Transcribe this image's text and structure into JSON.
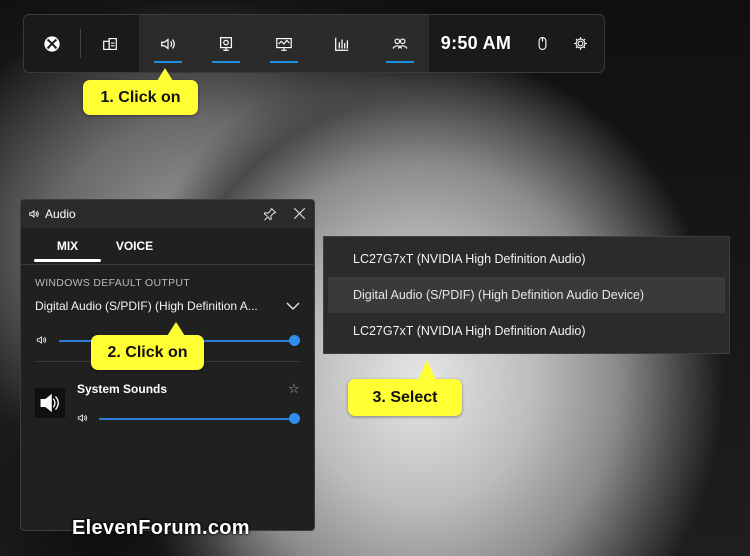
{
  "gamebar": {
    "clock": "9:50 AM",
    "icons": [
      "xbox-icon",
      "widget-store-icon",
      "audio-icon",
      "capture-icon",
      "performance-icon",
      "resources-icon",
      "xbox-social-icon",
      "mouse-icon",
      "settings-icon"
    ]
  },
  "callouts": {
    "step1": "1. Click on",
    "step2": "2. Click on",
    "step3": "3. Select"
  },
  "audio": {
    "title": "Audio",
    "tabs": [
      "MIX",
      "VOICE"
    ],
    "section_label": "WINDOWS DEFAULT OUTPUT",
    "device_name": "Digital Audio (S/PDIF) (High Definition A...",
    "master_volume": 1.0,
    "app": {
      "name": "System Sounds",
      "volume": 1.0
    }
  },
  "dropdown": {
    "options": [
      "LC27G7xT (NVIDIA High Definition Audio)",
      "Digital Audio (S/PDIF) (High Definition Audio Device)",
      "LC27G7xT (NVIDIA High Definition Audio)"
    ],
    "selected_index": 1
  },
  "watermark": "ElevenForum.com",
  "colors": {
    "accent": "#1e90e0",
    "callout": "#ffff33",
    "panel": "#202020"
  }
}
